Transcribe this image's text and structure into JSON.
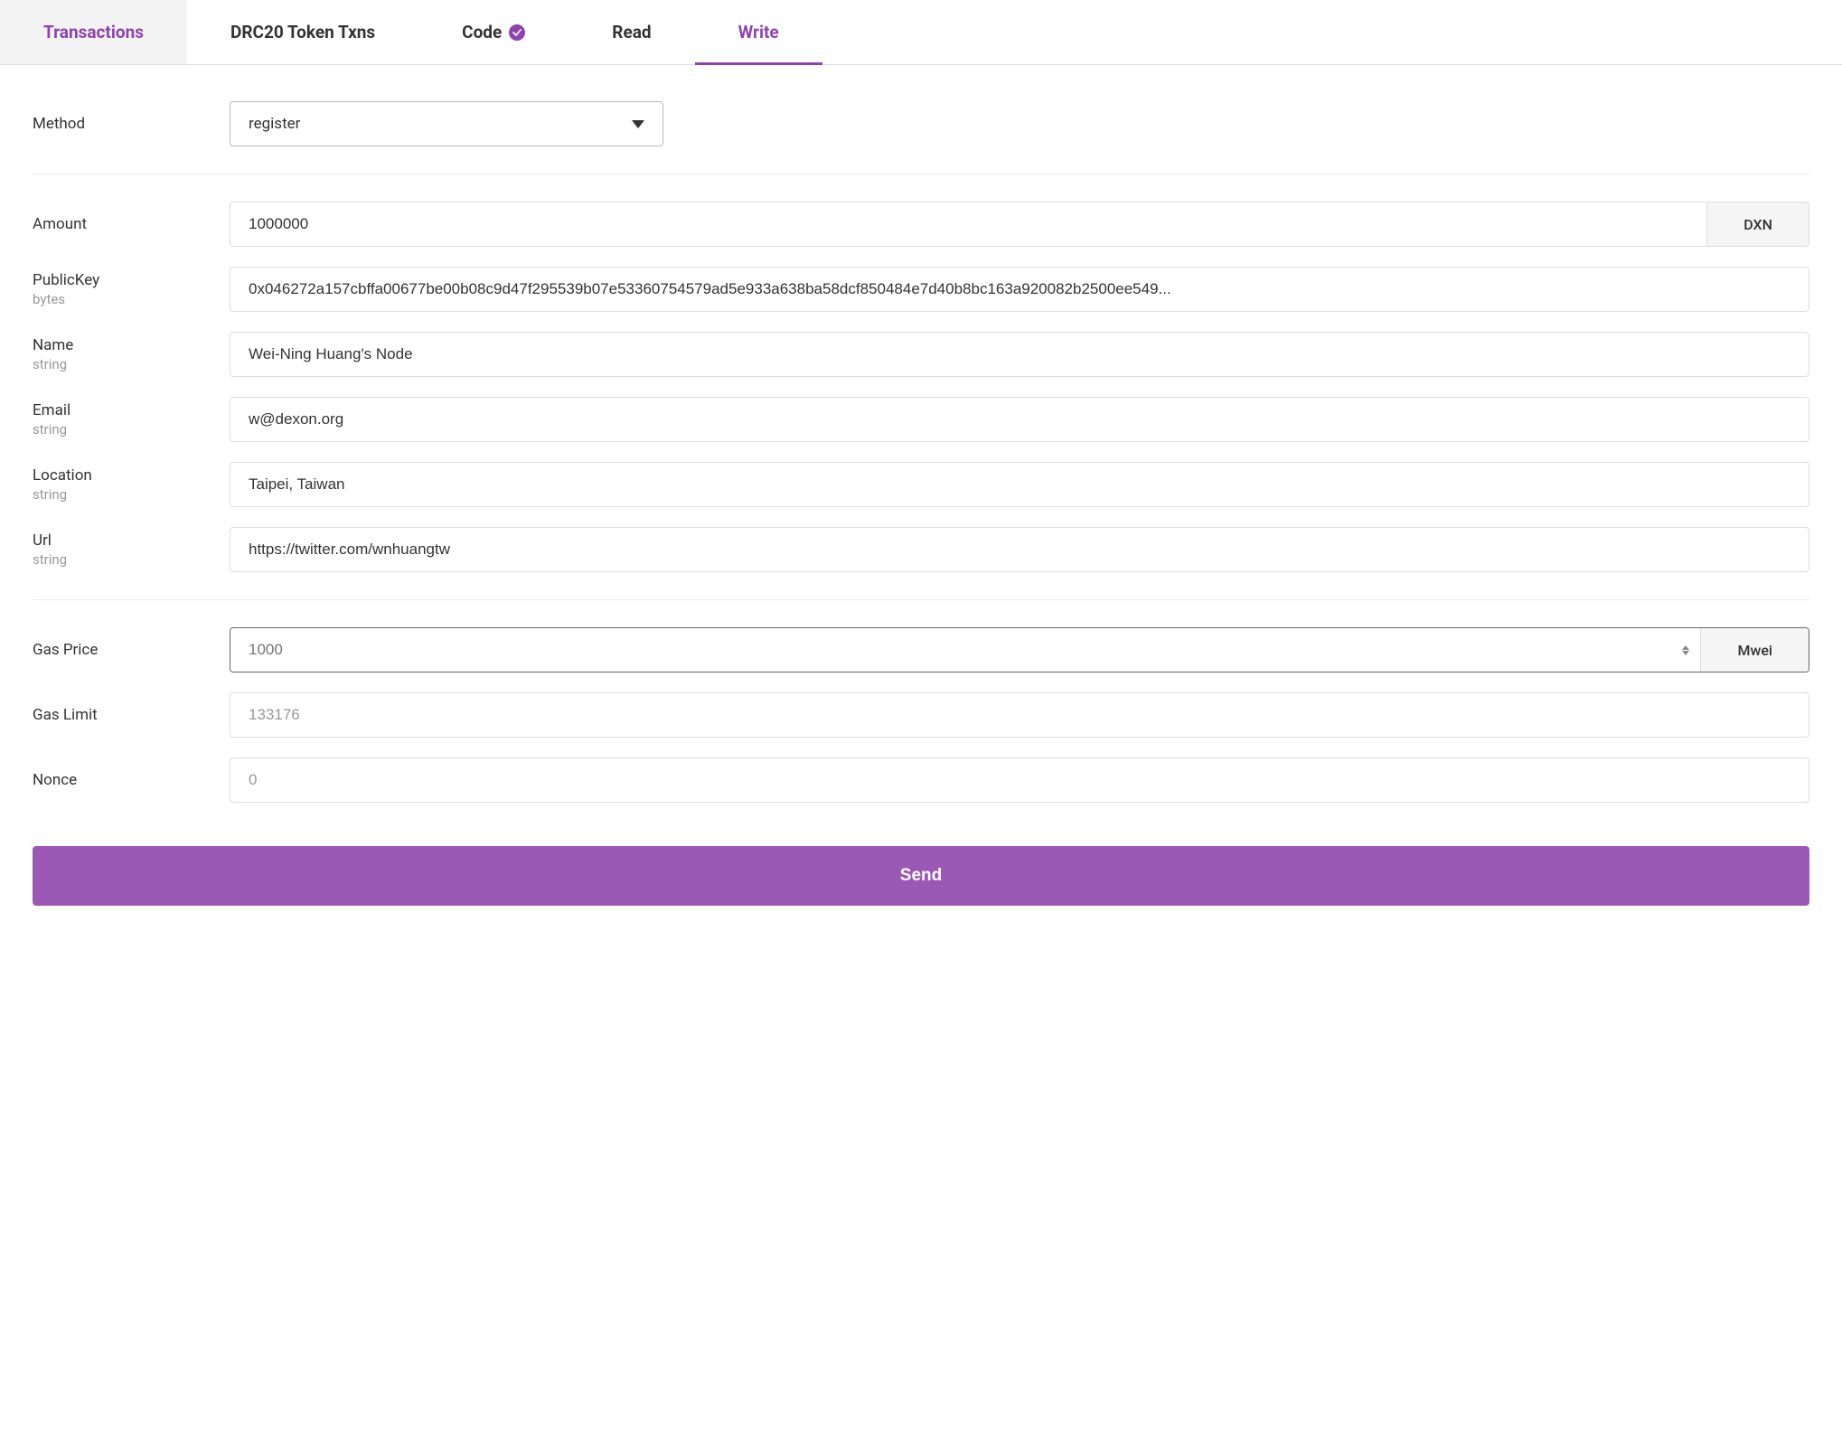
{
  "tabs": {
    "transactions": "Transactions",
    "drc20": "DRC20 Token Txns",
    "code": "Code",
    "read": "Read",
    "write": "Write"
  },
  "method": {
    "label": "Method",
    "value": "register"
  },
  "amount": {
    "label": "Amount",
    "value": "1000000",
    "unit": "DXN"
  },
  "publicKey": {
    "label": "PublicKey",
    "type": "bytes",
    "value": "0x046272a157cbffa00677be00b08c9d47f295539b07e53360754579ad5e933a638ba58dcf850484e7d40b8bc163a920082b2500ee549..."
  },
  "name": {
    "label": "Name",
    "type": "string",
    "value": "Wei-Ning Huang's Node"
  },
  "email": {
    "label": "Email",
    "type": "string",
    "value": "w@dexon.org"
  },
  "location": {
    "label": "Location",
    "type": "string",
    "value": "Taipei, Taiwan"
  },
  "url": {
    "label": "Url",
    "type": "string",
    "value": "https://twitter.com/wnhuangtw"
  },
  "gasPrice": {
    "label": "Gas Price",
    "placeholder": "1000",
    "unit": "Mwei"
  },
  "gasLimit": {
    "label": "Gas Limit",
    "placeholder": "133176"
  },
  "nonce": {
    "label": "Nonce",
    "placeholder": "0"
  },
  "sendButton": "Send"
}
